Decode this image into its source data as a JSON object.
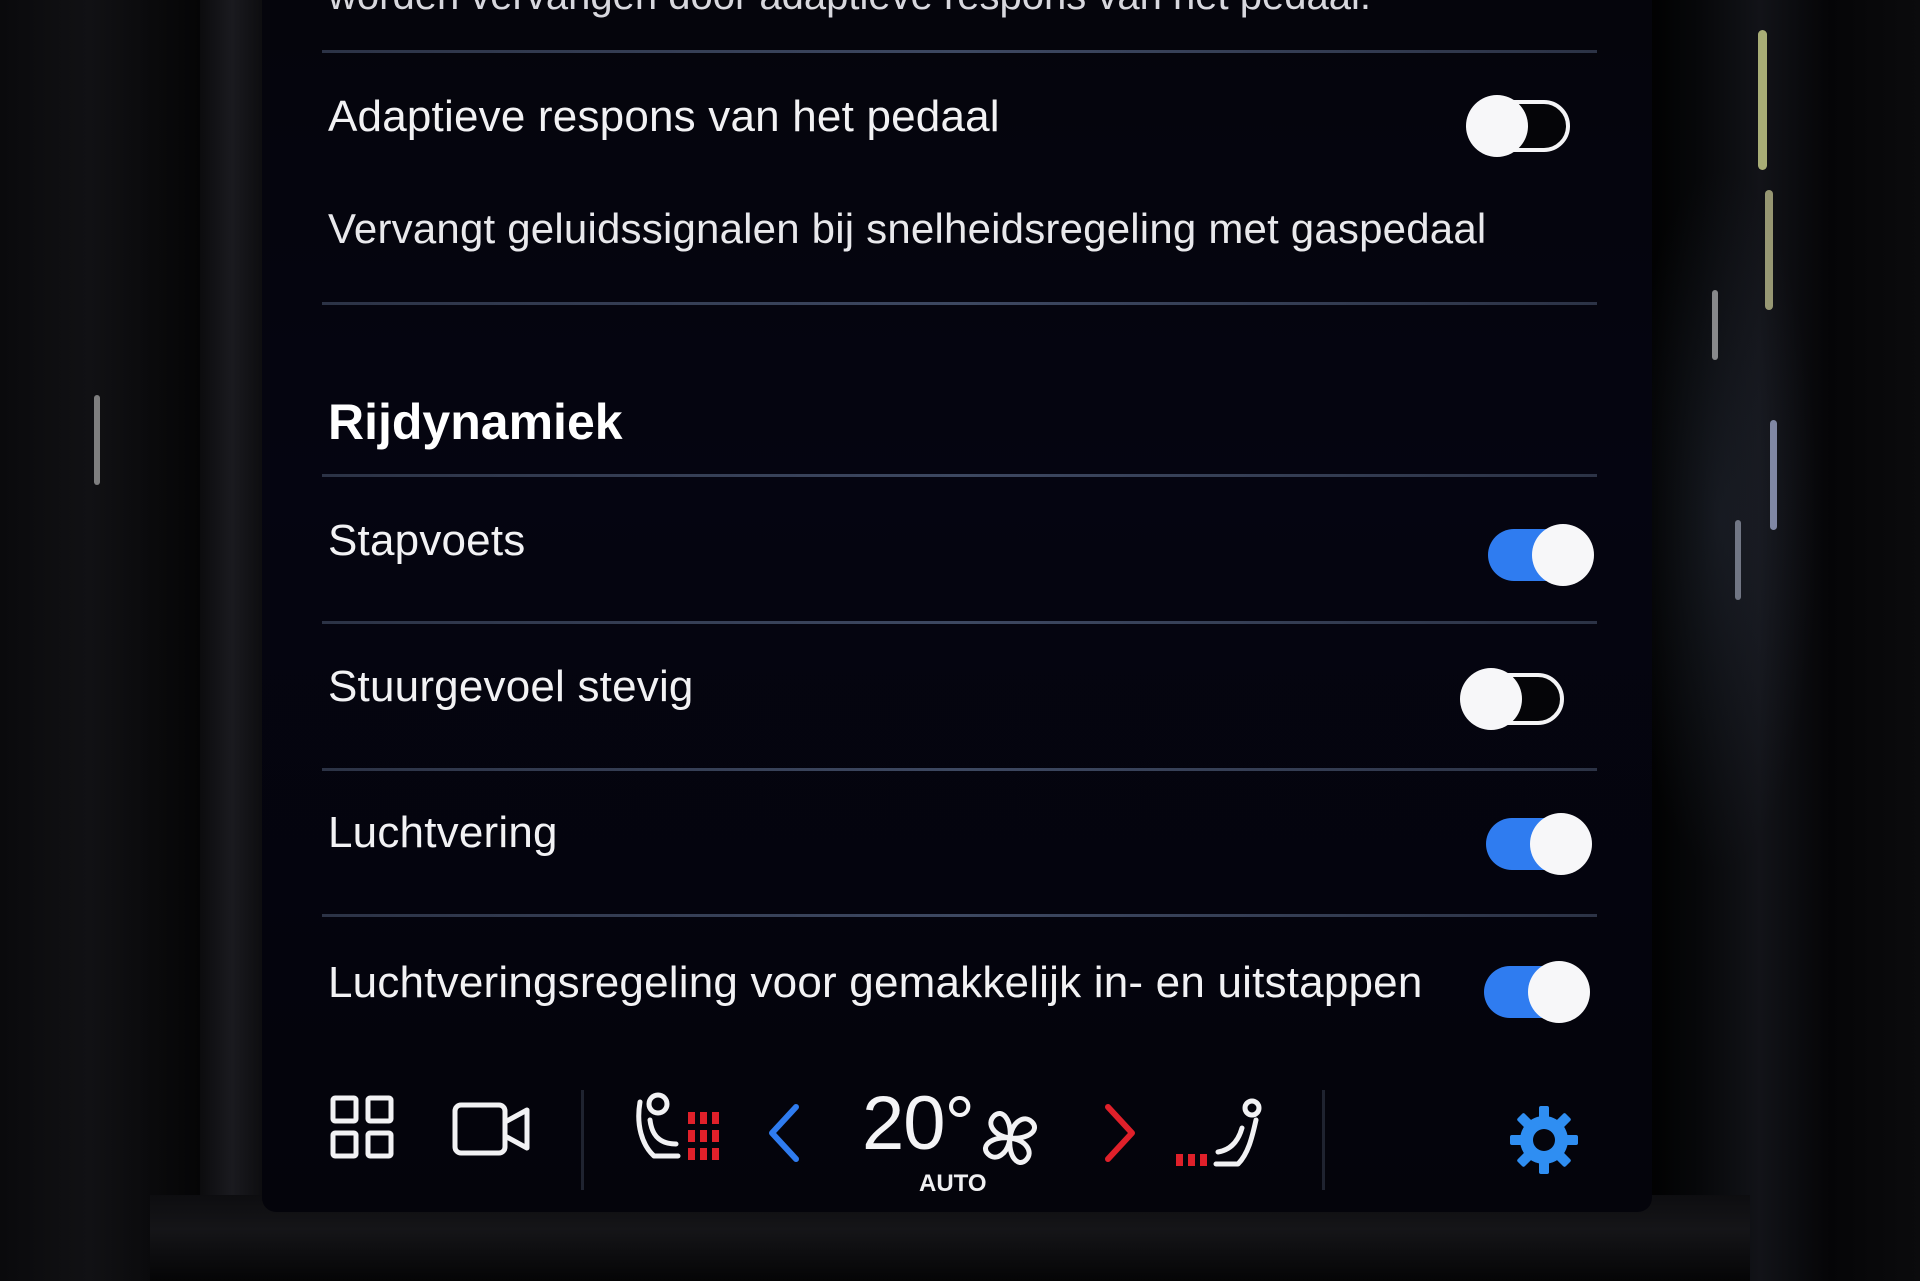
{
  "settings": {
    "truncated_top_text": "worden vervangen door adaptieve respons van het pedaal.",
    "pedal_row": {
      "label": "Adaptieve respons van het pedaal",
      "description": "Vervangt geluidssignalen bij snelheidsregeling met gaspedaal",
      "state": "off"
    },
    "section_title": "Rijdynamiek",
    "rows": [
      {
        "label": "Stapvoets",
        "state": "on"
      },
      {
        "label": "Stuurgevoel stevig",
        "state": "off"
      },
      {
        "label": "Luchtvering",
        "state": "on"
      },
      {
        "label": "Luchtveringsregeling voor gemakkelijk in- en uitstappen",
        "state": "on"
      }
    ]
  },
  "climate_bar": {
    "temperature": "20°",
    "mode": "AUTO",
    "icons": [
      "home-grid-icon",
      "camera-icon",
      "seat-heat-left-icon",
      "temp-decrease-icon",
      "fan-icon",
      "temp-increase-icon",
      "seat-heat-right-icon",
      "settings-gear-icon"
    ]
  },
  "colors": {
    "accent": "#2f7cf0",
    "heat": "#e0202a",
    "text": "#f2f2f4",
    "background": "#05050c"
  }
}
